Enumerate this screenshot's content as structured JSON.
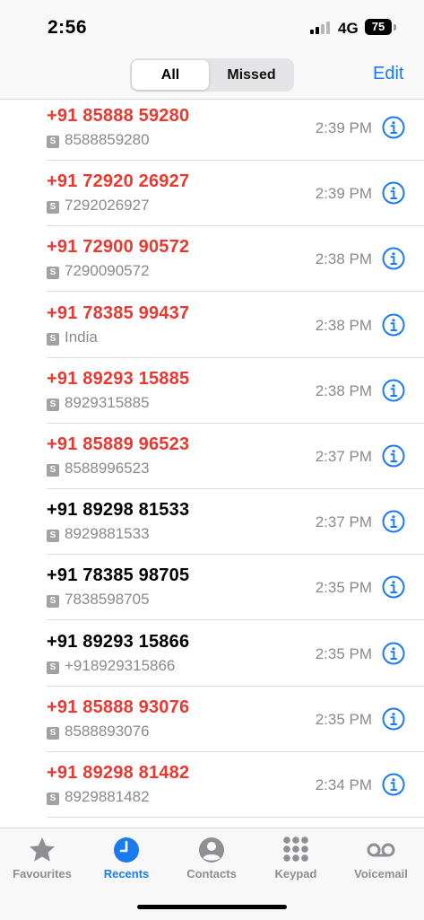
{
  "status_bar": {
    "time": "2:56",
    "network": "4G",
    "battery": "75"
  },
  "header": {
    "segments": [
      "All",
      "Missed"
    ],
    "selected_segment": "All",
    "edit_label": "Edit"
  },
  "calls": [
    {
      "number": "+91 85888 59280",
      "detail": "8588859280",
      "time": "2:39 PM",
      "missed": true
    },
    {
      "number": "+91 72920 26927",
      "detail": "7292026927",
      "time": "2:39 PM",
      "missed": true
    },
    {
      "number": "+91 72900 90572",
      "detail": "7290090572",
      "time": "2:38 PM",
      "missed": true
    },
    {
      "number": "+91 78385 99437",
      "detail": "India",
      "time": "2:38 PM",
      "missed": true
    },
    {
      "number": "+91 89293 15885",
      "detail": "8929315885",
      "time": "2:38 PM",
      "missed": true
    },
    {
      "number": "+91 85889 96523",
      "detail": "8588996523",
      "time": "2:37 PM",
      "missed": true
    },
    {
      "number": "+91 89298 81533",
      "detail": "8929881533",
      "time": "2:37 PM",
      "missed": false
    },
    {
      "number": "+91 78385 98705",
      "detail": "7838598705",
      "time": "2:35 PM",
      "missed": false
    },
    {
      "number": "+91 89293 15866",
      "detail": "+918929315866",
      "time": "2:35 PM",
      "missed": false
    },
    {
      "number": "+91 85888 93076",
      "detail": "8588893076",
      "time": "2:35 PM",
      "missed": true
    },
    {
      "number": "+91 89298 81482",
      "detail": "8929881482",
      "time": "2:34 PM",
      "missed": true
    }
  ],
  "sim_badge": "S",
  "tabs": [
    {
      "label": "Favourites",
      "icon": "star-icon",
      "active": false
    },
    {
      "label": "Recents",
      "icon": "clock-icon",
      "active": true
    },
    {
      "label": "Contacts",
      "icon": "person-icon",
      "active": false
    },
    {
      "label": "Keypad",
      "icon": "keypad-icon",
      "active": false
    },
    {
      "label": "Voicemail",
      "icon": "voicemail-icon",
      "active": false
    }
  ],
  "colors": {
    "accent": "#1a7bf0",
    "missed": "#e8382f",
    "secondary_text": "#8a8a8e",
    "inactive_tab": "#8e8e93"
  }
}
